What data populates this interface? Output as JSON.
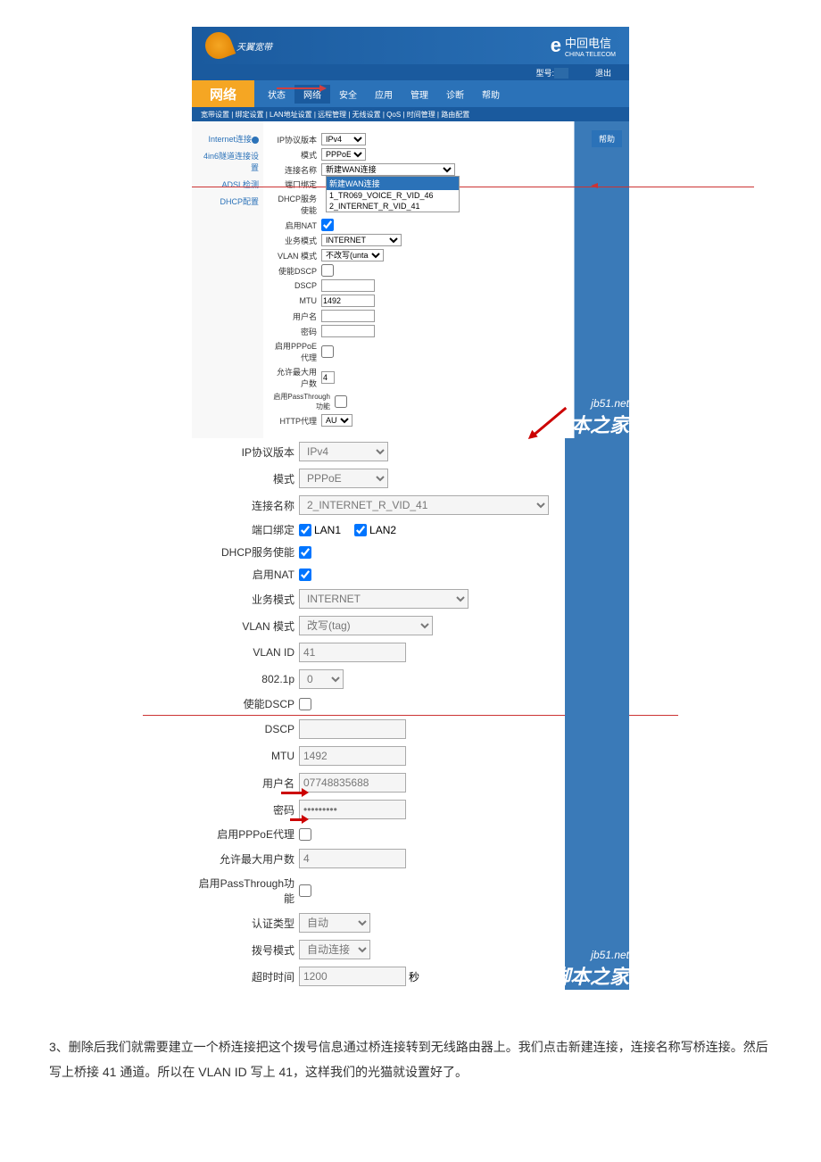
{
  "admin": {
    "logo_text": "天翼宽带",
    "telecom": "中回电信",
    "telecom_sub": "CHINA TELECOM",
    "toolbar": {
      "label1": "型号:",
      "value1": "",
      "label2": "退出"
    },
    "nav_active": "网络",
    "nav_items": [
      "状态",
      "网络",
      "安全",
      "应用",
      "管理",
      "诊断",
      "帮助"
    ],
    "subnav": "宽带设置 | 绑定设置 | LAN地址设置 | 远程管理 | 无线设置 | QoS | 时间管理 | 路由配置",
    "sidebar": [
      "Internet连接",
      "4in6隧道连接设置",
      "ADSL检测",
      "DHCP配置"
    ],
    "help_btn": "帮助"
  },
  "small_form": {
    "ip_version_label": "IP协议版本",
    "ip_version": "IPv4",
    "mode_label": "模式",
    "mode": "PPPoE",
    "conn_name_label": "连接名称",
    "conn_name": "新建WAN连接",
    "port_bind_label": "端口绑定",
    "dhcp_enable_label": "DHCP服务使能",
    "dropdown": [
      "新建WAN连接",
      "1_TR069_VOICE_R_VID_46",
      "2_INTERNET_R_VID_41"
    ],
    "nat_label": "启用NAT",
    "service_label": "业务模式",
    "service": "INTERNET",
    "vlan_mode_label": "VLAN 模式",
    "vlan_mode": "不改写(untag)",
    "enable_dscp_label": "使能DSCP",
    "dscp_label": "DSCP",
    "mtu_label": "MTU",
    "mtu": "1492",
    "user_label": "用户名",
    "pwd_label": "密码",
    "pppoe_proxy_label": "启用PPPoE代理",
    "max_user_label": "允许最大用户数",
    "max_user": "4",
    "passthrough_label": "启用PassThrough功能",
    "http_label": "HTTP代理",
    "http": "AUTO"
  },
  "form": {
    "ip_version_label": "IP协议版本",
    "ip_version": "IPv4",
    "mode_label": "模式",
    "mode": "PPPoE",
    "conn_name_label": "连接名称",
    "conn_name": "2_INTERNET_R_VID_41",
    "port_bind_label": "端口绑定",
    "lan1": "LAN1",
    "lan2": "LAN2",
    "dhcp_enable_label": "DHCP服务使能",
    "nat_label": "启用NAT",
    "service_label": "业务模式",
    "service": "INTERNET",
    "vlan_mode_label": "VLAN 模式",
    "vlan_mode": "改写(tag)",
    "vlan_id_label": "VLAN ID",
    "vlan_id": "41",
    "dot1p_label": "802.1p",
    "dot1p": "0",
    "enable_dscp_label": "使能DSCP",
    "dscp_label": "DSCP",
    "mtu_label": "MTU",
    "mtu": "1492",
    "user_label": "用户名",
    "user": "07748835688",
    "pwd_label": "密码",
    "pwd": "•••••••••",
    "pppoe_proxy_label": "启用PPPoE代理",
    "max_user_label": "允许最大用户数",
    "max_user": "4",
    "passthrough_label": "启用PassThrough功能",
    "auth_type_label": "认证类型",
    "auth_type": "自动",
    "dial_mode_label": "拨号模式",
    "dial_mode": "自动连接",
    "timeout_label": "超时时间",
    "timeout": "1200",
    "timeout_unit": "秒"
  },
  "watermark": {
    "url": "jb51.net",
    "cn": "脚本之家"
  },
  "instruction": "3、删除后我们就需要建立一个桥连接把这个拨号信息通过桥连接转到无线路由器上。我们点击新建连接，连接名称写桥连接。然后写上桥接 41 通道。所以在 VLAN ID 写上 41，这样我们的光猫就设置好了。"
}
